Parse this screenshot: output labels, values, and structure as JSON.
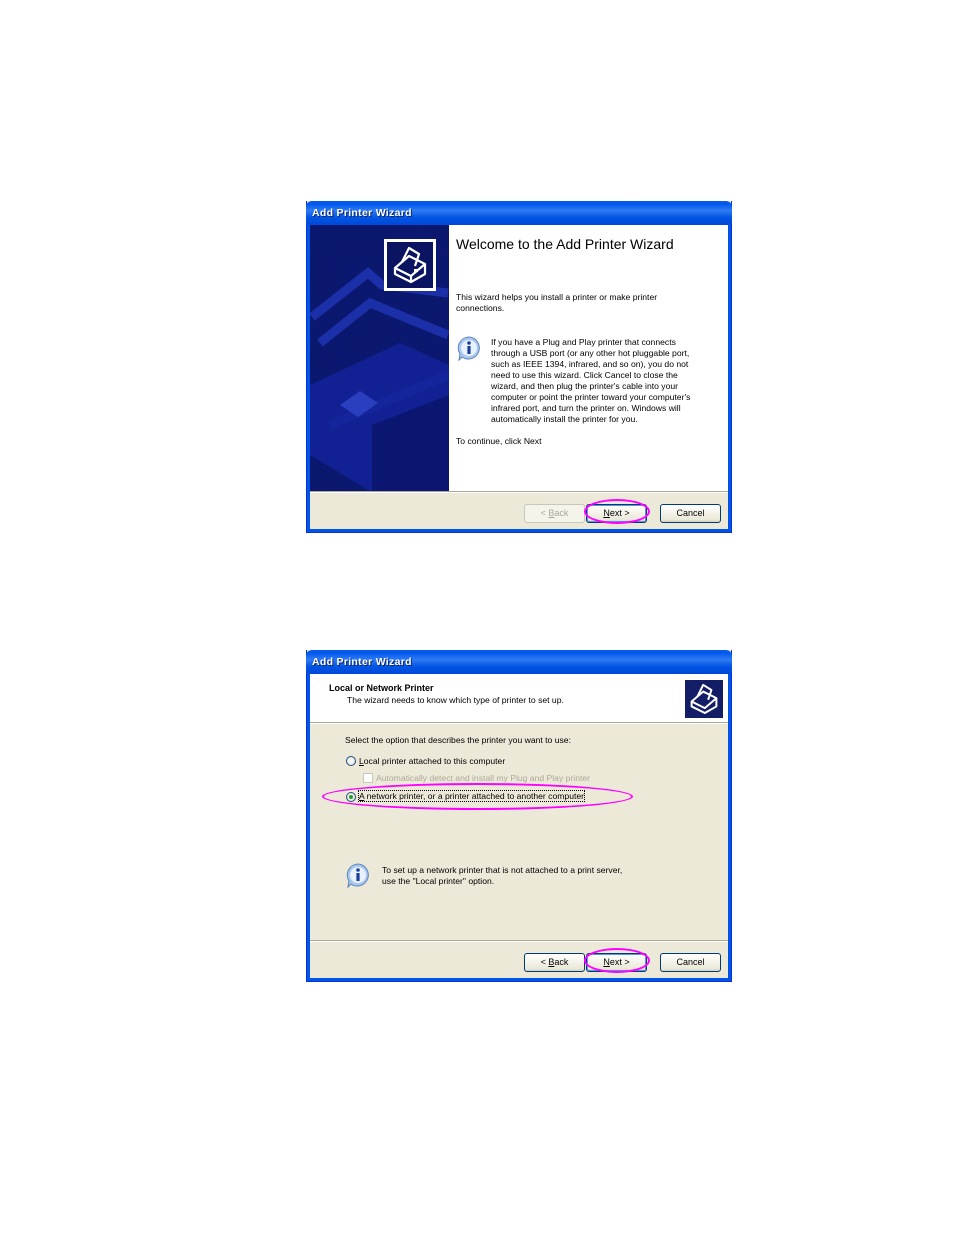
{
  "dialogs": [
    {
      "title": "Add Printer Wizard",
      "page": "welcome",
      "heading": "Welcome to the Add Printer Wizard",
      "intro": "This wizard helps you install a printer or make printer connections.",
      "info_text": "If you have a Plug and Play printer that connects through a USB port (or any other hot pluggable port, such as IEEE 1394, infrared, and so on), you do not need to use this wizard. Click Cancel to close the wizard, and then plug the printer's cable into your computer or point the printer toward your computer's infrared port, and turn the printer on. Windows will automatically install the printer for you.",
      "continue_text": "To continue, click Next",
      "buttons": {
        "back": {
          "label_prefix": "< ",
          "accel": "B",
          "rest": "ack",
          "enabled": false
        },
        "next": {
          "accel": "N",
          "rest": "ext >",
          "enabled": true,
          "default": true
        },
        "cancel": {
          "label": "Cancel",
          "enabled": true
        }
      },
      "annotation": {
        "target": "next",
        "color": "#ff00ff"
      }
    },
    {
      "title": "Add Printer Wizard",
      "page": "local-or-network",
      "header_title": "Local or Network Printer",
      "header_subtitle": "The wizard needs to know which type of printer to set up.",
      "prompt": "Select the option that describes the printer you want to use:",
      "options": [
        {
          "accel": "L",
          "rest": "ocal printer attached to this computer",
          "type": "radio",
          "checked": false
        },
        {
          "label": "Automatically detect and install my Plug and Play printer",
          "type": "checkbox",
          "checked": false,
          "enabled": false
        },
        {
          "accel": "A",
          "rest": " network printer, or a printer attached to another computer",
          "type": "radio",
          "checked": true
        }
      ],
      "info_text_line1": "To set up a network printer that is not attached to a print server,",
      "info_text_line2": "use the \"Local printer\" option.",
      "buttons": {
        "back": {
          "label_prefix": "< ",
          "accel": "B",
          "rest": "ack",
          "enabled": true
        },
        "next": {
          "accel": "N",
          "rest": "ext >",
          "enabled": true,
          "default": true
        },
        "cancel": {
          "label": "Cancel",
          "enabled": true
        }
      },
      "annotation": {
        "targets": [
          "network-printer-option",
          "next"
        ],
        "color": "#ff00ff"
      }
    }
  ],
  "colors": {
    "titlebar": "#0054e3",
    "dialog_bg": "#ece9d8",
    "sidebar": "#0c1a7a",
    "highlight": "#ff00ff"
  }
}
